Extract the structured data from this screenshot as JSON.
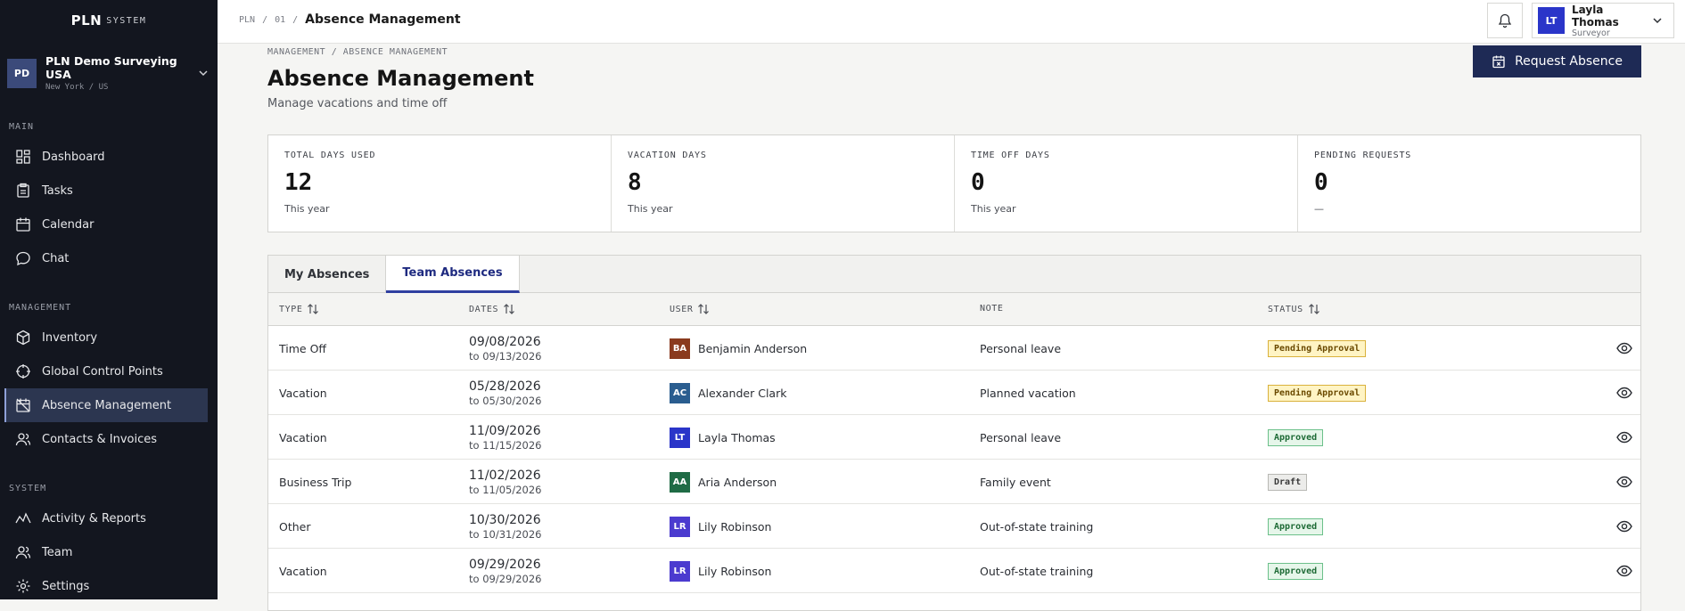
{
  "brand": {
    "main": "PLN",
    "sub": "SYSTEM"
  },
  "org": {
    "badge": "PD",
    "name": "PLN Demo Surveying USA",
    "location": "New York / US"
  },
  "nav": {
    "sections": [
      {
        "label": "MAIN",
        "items": [
          {
            "label": "Dashboard",
            "icon": "dashboard-icon"
          },
          {
            "label": "Tasks",
            "icon": "clipboard-icon"
          },
          {
            "label": "Calendar",
            "icon": "calendar-icon"
          },
          {
            "label": "Chat",
            "icon": "chat-icon"
          }
        ]
      },
      {
        "label": "MANAGEMENT",
        "items": [
          {
            "label": "Inventory",
            "icon": "box-icon"
          },
          {
            "label": "Global Control Points",
            "icon": "crosshair-icon"
          },
          {
            "label": "Absence Management",
            "icon": "calendar-off-icon",
            "active": true
          },
          {
            "label": "Contacts & Invoices",
            "icon": "users-icon"
          }
        ]
      },
      {
        "label": "SYSTEM",
        "items": [
          {
            "label": "Activity & Reports",
            "icon": "activity-icon"
          },
          {
            "label": "Team",
            "icon": "team-icon"
          },
          {
            "label": "Settings",
            "icon": "gear-icon"
          }
        ]
      }
    ]
  },
  "header": {
    "crumbs": [
      "PLN",
      "/",
      "01",
      "/"
    ],
    "current": "Absence Management",
    "user": {
      "initials": "LT",
      "name": "Layla Thomas",
      "role": "Surveyor"
    }
  },
  "page": {
    "breadcrumb": "MANAGEMENT / ABSENCE MANAGEMENT",
    "title": "Absence Management",
    "subtitle": "Manage vacations and time off",
    "request_button": "Request Absence"
  },
  "stats": [
    {
      "label": "TOTAL DAYS USED",
      "value": "12",
      "note": "This year"
    },
    {
      "label": "VACATION DAYS",
      "value": "8",
      "note": "This year"
    },
    {
      "label": "TIME OFF DAYS",
      "value": "0",
      "note": "This year"
    },
    {
      "label": "PENDING REQUESTS",
      "value": "0",
      "note": "—"
    }
  ],
  "tabs": [
    {
      "label": "My Absences",
      "active": false
    },
    {
      "label": "Team Absences",
      "active": true
    }
  ],
  "table": {
    "columns": [
      "TYPE",
      "DATES",
      "USER",
      "NOTE",
      "STATUS"
    ],
    "rows": [
      {
        "type": "Time Off",
        "from": "09/08/2026",
        "to": "to 09/13/2026",
        "initials": "BA",
        "avatar_color": "#8a3a1e",
        "user": "Benjamin Anderson",
        "note": "Personal leave",
        "status": "Pending Approval",
        "status_kind": "pending"
      },
      {
        "type": "Vacation",
        "from": "05/28/2026",
        "to": "to 05/30/2026",
        "initials": "AC",
        "avatar_color": "#2a5d8f",
        "user": "Alexander Clark",
        "note": "Planned vacation",
        "status": "Pending Approval",
        "status_kind": "pending"
      },
      {
        "type": "Vacation",
        "from": "11/09/2026",
        "to": "to 11/15/2026",
        "initials": "LT",
        "avatar_color": "#2a35c9",
        "user": "Layla Thomas",
        "note": "Personal leave",
        "status": "Approved",
        "status_kind": "approved"
      },
      {
        "type": "Business Trip",
        "from": "11/02/2026",
        "to": "to 11/05/2026",
        "initials": "AA",
        "avatar_color": "#1f6b45",
        "user": "Aria Anderson",
        "note": "Family event",
        "status": "Draft",
        "status_kind": "draft"
      },
      {
        "type": "Other",
        "from": "10/30/2026",
        "to": "to 10/31/2026",
        "initials": "LR",
        "avatar_color": "#4b3bcf",
        "user": "Lily Robinson",
        "note": "Out-of-state training",
        "status": "Approved",
        "status_kind": "approved"
      },
      {
        "type": "Vacation",
        "from": "09/29/2026",
        "to": "to 09/29/2026",
        "initials": "LR",
        "avatar_color": "#4b3bcf",
        "user": "Lily Robinson",
        "note": "Out-of-state training",
        "status": "Approved",
        "status_kind": "approved"
      }
    ]
  },
  "colors": {
    "sidebar_bg": "#13161f",
    "accent": "#1e2a55",
    "pending_bg": "#fff4c4",
    "pending_border": "#d9b13c",
    "pending_text": "#6b4a00",
    "approved_bg": "#e6f6ea",
    "approved_border": "#6cc08a",
    "approved_text": "#1d6a35",
    "draft_bg": "#ececea",
    "draft_border": "#b8b8b4",
    "draft_text": "#3a3a3a"
  }
}
